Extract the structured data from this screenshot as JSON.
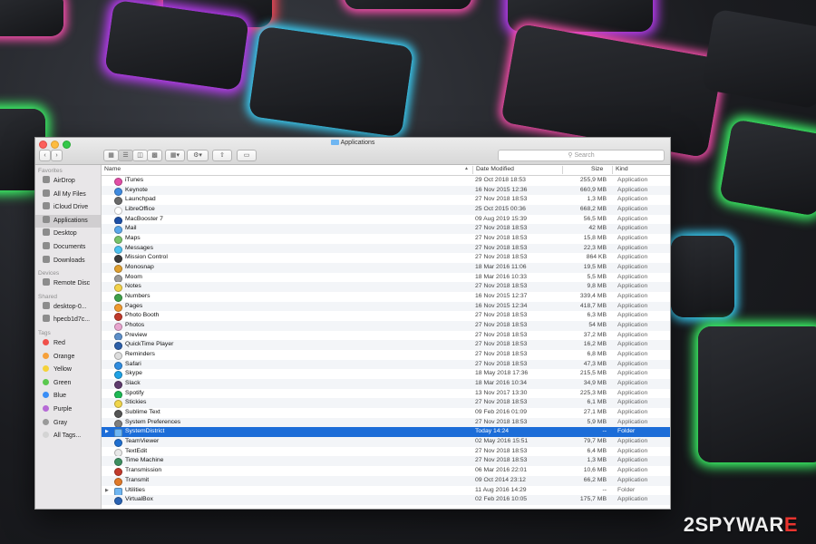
{
  "window": {
    "title": "Applications",
    "search_placeholder": "Search"
  },
  "sidebar": {
    "sections": [
      {
        "heading": "Favorites",
        "items": [
          {
            "label": "AirDrop",
            "icon": "airdrop-icon"
          },
          {
            "label": "All My Files",
            "icon": "all-files-icon"
          },
          {
            "label": "iCloud Drive",
            "icon": "cloud-icon"
          },
          {
            "label": "Applications",
            "icon": "applications-icon",
            "selected": true
          },
          {
            "label": "Desktop",
            "icon": "desktop-icon"
          },
          {
            "label": "Documents",
            "icon": "documents-icon"
          },
          {
            "label": "Downloads",
            "icon": "downloads-icon"
          }
        ]
      },
      {
        "heading": "Devices",
        "items": [
          {
            "label": "Remote Disc",
            "icon": "disc-icon"
          }
        ]
      },
      {
        "heading": "Shared",
        "items": [
          {
            "label": "desktop-0...",
            "icon": "computer-icon"
          },
          {
            "label": "hpecb1d7c...",
            "icon": "computer-icon"
          }
        ]
      },
      {
        "heading": "Tags",
        "items": [
          {
            "label": "Red",
            "color": "#f0504a"
          },
          {
            "label": "Orange",
            "color": "#f6a03a"
          },
          {
            "label": "Yellow",
            "color": "#f5d23a"
          },
          {
            "label": "Green",
            "color": "#5ac84e"
          },
          {
            "label": "Blue",
            "color": "#3a8ef6"
          },
          {
            "label": "Purple",
            "color": "#b66ad6"
          },
          {
            "label": "Gray",
            "color": "#9a9a9a"
          },
          {
            "label": "All Tags...",
            "color": "#d4d4d4"
          }
        ]
      }
    ]
  },
  "columns": {
    "name": "Name",
    "date": "Date Modified",
    "size": "Size",
    "kind": "Kind"
  },
  "files": [
    {
      "name": "iTunes",
      "date": "29 Oct 2018 18:53",
      "size": "255,9 MB",
      "kind": "Application",
      "icon_color": "#e24ea6"
    },
    {
      "name": "Keynote",
      "date": "16 Nov 2015 12:36",
      "size": "660,9 MB",
      "kind": "Application",
      "icon_color": "#3f8be0"
    },
    {
      "name": "Launchpad",
      "date": "27 Nov 2018 18:53",
      "size": "1,3 MB",
      "kind": "Application",
      "icon_color": "#6a6a6a"
    },
    {
      "name": "LibreOffice",
      "date": "25 Oct 2015 00:36",
      "size": "668,2 MB",
      "kind": "Application",
      "icon_color": "#ffffff"
    },
    {
      "name": "MacBooster 7",
      "date": "09 Aug 2019 15:39",
      "size": "56,5 MB",
      "kind": "Application",
      "icon_color": "#1d4fa5"
    },
    {
      "name": "Mail",
      "date": "27 Nov 2018 18:53",
      "size": "42 MB",
      "kind": "Application",
      "icon_color": "#5aa7ea"
    },
    {
      "name": "Maps",
      "date": "27 Nov 2018 18:53",
      "size": "15,8 MB",
      "kind": "Application",
      "icon_color": "#78c36a"
    },
    {
      "name": "Messages",
      "date": "27 Nov 2018 18:53",
      "size": "22,3 MB",
      "kind": "Application",
      "icon_color": "#4cc2f0"
    },
    {
      "name": "Mission Control",
      "date": "27 Nov 2018 18:53",
      "size": "864 KB",
      "kind": "Application",
      "icon_color": "#3c3c3c"
    },
    {
      "name": "Monosnap",
      "date": "18 Mar 2016 11:06",
      "size": "19,5 MB",
      "kind": "Application",
      "icon_color": "#e0a030"
    },
    {
      "name": "Moom",
      "date": "18 Mar 2016 10:33",
      "size": "5,5 MB",
      "kind": "Application",
      "icon_color": "#9a9a9a"
    },
    {
      "name": "Notes",
      "date": "27 Nov 2018 18:53",
      "size": "9,8 MB",
      "kind": "Application",
      "icon_color": "#f3d24a"
    },
    {
      "name": "Numbers",
      "date": "16 Nov 2015 12:37",
      "size": "339,4 MB",
      "kind": "Application",
      "icon_color": "#3fa04a"
    },
    {
      "name": "Pages",
      "date": "16 Nov 2015 12:34",
      "size": "418,7 MB",
      "kind": "Application",
      "icon_color": "#f09a30"
    },
    {
      "name": "Photo Booth",
      "date": "27 Nov 2018 18:53",
      "size": "6,3 MB",
      "kind": "Application",
      "icon_color": "#c0392b"
    },
    {
      "name": "Photos",
      "date": "27 Nov 2018 18:53",
      "size": "54 MB",
      "kind": "Application",
      "icon_color": "#e8a5cf"
    },
    {
      "name": "Preview",
      "date": "27 Nov 2018 18:53",
      "size": "37,2 MB",
      "kind": "Application",
      "icon_color": "#5d8fc9"
    },
    {
      "name": "QuickTime Player",
      "date": "27 Nov 2018 18:53",
      "size": "16,2 MB",
      "kind": "Application",
      "icon_color": "#2b5ea8"
    },
    {
      "name": "Reminders",
      "date": "27 Nov 2018 18:53",
      "size": "6,8 MB",
      "kind": "Application",
      "icon_color": "#dddddd"
    },
    {
      "name": "Safari",
      "date": "27 Nov 2018 18:53",
      "size": "47,3 MB",
      "kind": "Application",
      "icon_color": "#2e8ce0"
    },
    {
      "name": "Skype",
      "date": "18 May 2018 17:36",
      "size": "215,5 MB",
      "kind": "Application",
      "icon_color": "#1fa3e6"
    },
    {
      "name": "Slack",
      "date": "18 Mar 2016 10:34",
      "size": "34,9 MB",
      "kind": "Application",
      "icon_color": "#5f3b6d"
    },
    {
      "name": "Spotify",
      "date": "13 Nov 2017 13:30",
      "size": "225,3 MB",
      "kind": "Application",
      "icon_color": "#1db954"
    },
    {
      "name": "Stickies",
      "date": "27 Nov 2018 18:53",
      "size": "6,1 MB",
      "kind": "Application",
      "icon_color": "#f0d54a"
    },
    {
      "name": "Sublime Text",
      "date": "09 Feb 2016 01:09",
      "size": "27,1 MB",
      "kind": "Application",
      "icon_color": "#555555"
    },
    {
      "name": "System Preferences",
      "date": "27 Nov 2018 18:53",
      "size": "5,9 MB",
      "kind": "Application",
      "icon_color": "#7d7d7d"
    },
    {
      "name": "SystemDistrict",
      "date": "Today 14:24",
      "size": "--",
      "kind": "Folder",
      "icon_color": "#6fb6f2",
      "folder": true,
      "selected": true
    },
    {
      "name": "TeamViewer",
      "date": "02 May 2016 15:51",
      "size": "79,7 MB",
      "kind": "Application",
      "icon_color": "#1f6fd0"
    },
    {
      "name": "TextEdit",
      "date": "27 Nov 2018 18:53",
      "size": "6,4 MB",
      "kind": "Application",
      "icon_color": "#e8e8e8"
    },
    {
      "name": "Time Machine",
      "date": "27 Nov 2018 18:53",
      "size": "1,3 MB",
      "kind": "Application",
      "icon_color": "#3d8f60"
    },
    {
      "name": "Transmission",
      "date": "06 Mar 2016 22:01",
      "size": "10,6 MB",
      "kind": "Application",
      "icon_color": "#c33a2b"
    },
    {
      "name": "Transmit",
      "date": "09 Oct 2014 23:12",
      "size": "66,2 MB",
      "kind": "Application",
      "icon_color": "#e07a2a"
    },
    {
      "name": "Utilities",
      "date": "11 Aug 2016 14:29",
      "size": "--",
      "kind": "Folder",
      "icon_color": "#6fb6f2",
      "folder": true
    },
    {
      "name": "VirtualBox",
      "date": "02 Feb 2016 10:05",
      "size": "175,7 MB",
      "kind": "Application",
      "icon_color": "#2a63b3"
    }
  ],
  "watermark": {
    "part1": "2",
    "part2": "SPYWAR",
    "part3": "E"
  }
}
